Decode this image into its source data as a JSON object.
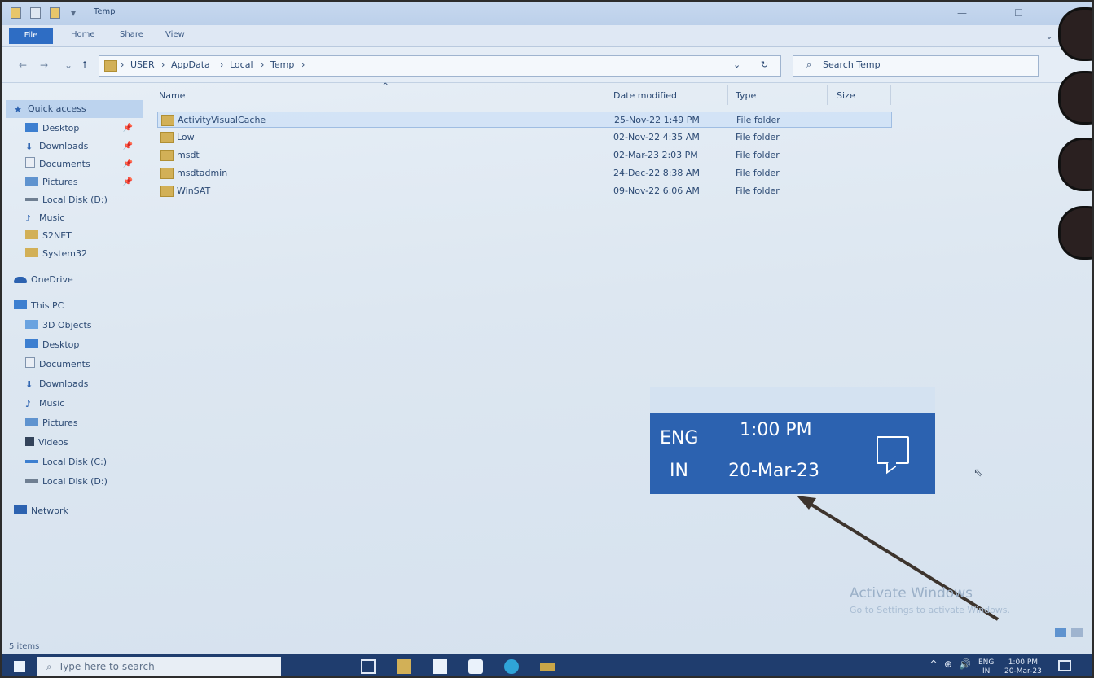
{
  "window": {
    "title": "Temp",
    "tabs": [
      "File",
      "Home",
      "Share",
      "View"
    ]
  },
  "address": {
    "crumbs": [
      "USER",
      "AppData",
      "Local",
      "Temp"
    ],
    "search_placeholder": "Search Temp"
  },
  "sidebar": {
    "quick_access": "Quick access",
    "quick": [
      "Desktop",
      "Downloads",
      "Documents",
      "Pictures",
      "Local Disk (D:)",
      "Music",
      "S2NET",
      "System32"
    ],
    "onedrive": "OneDrive",
    "this_pc": "This PC",
    "pc": [
      "3D Objects",
      "Desktop",
      "Documents",
      "Downloads",
      "Music",
      "Pictures",
      "Videos",
      "Local Disk (C:)",
      "Local Disk (D:)"
    ],
    "network": "Network"
  },
  "columns": [
    "Name",
    "Date modified",
    "Type",
    "Size"
  ],
  "files": [
    {
      "name": "ActivityVisualCache",
      "date": "25-Nov-22 1:49 PM",
      "type": "File folder"
    },
    {
      "name": "Low",
      "date": "02-Nov-22 4:35 AM",
      "type": "File folder"
    },
    {
      "name": "msdt",
      "date": "02-Mar-23 2:03 PM",
      "type": "File folder"
    },
    {
      "name": "msdtadmin",
      "date": "24-Dec-22 8:38 AM",
      "type": "File folder"
    },
    {
      "name": "WinSAT",
      "date": "09-Nov-22 6:06 AM",
      "type": "File folder"
    }
  ],
  "status": "5 items",
  "zoom": {
    "lang": "ENG",
    "region": "IN",
    "time": "1:00 PM",
    "date": "20-Mar-23"
  },
  "watermark": {
    "line1": "Activate Windows",
    "line2": "Go to Settings to activate Windows."
  },
  "taskbar": {
    "search_placeholder": "Type here to search",
    "lang": "ENG",
    "region": "IN",
    "time": "1:00 PM",
    "date": "20-Mar-23"
  },
  "colors": {
    "accent": "#2c62b0",
    "taskbar": "#1f3d6e",
    "arrow": "#3d342d"
  }
}
